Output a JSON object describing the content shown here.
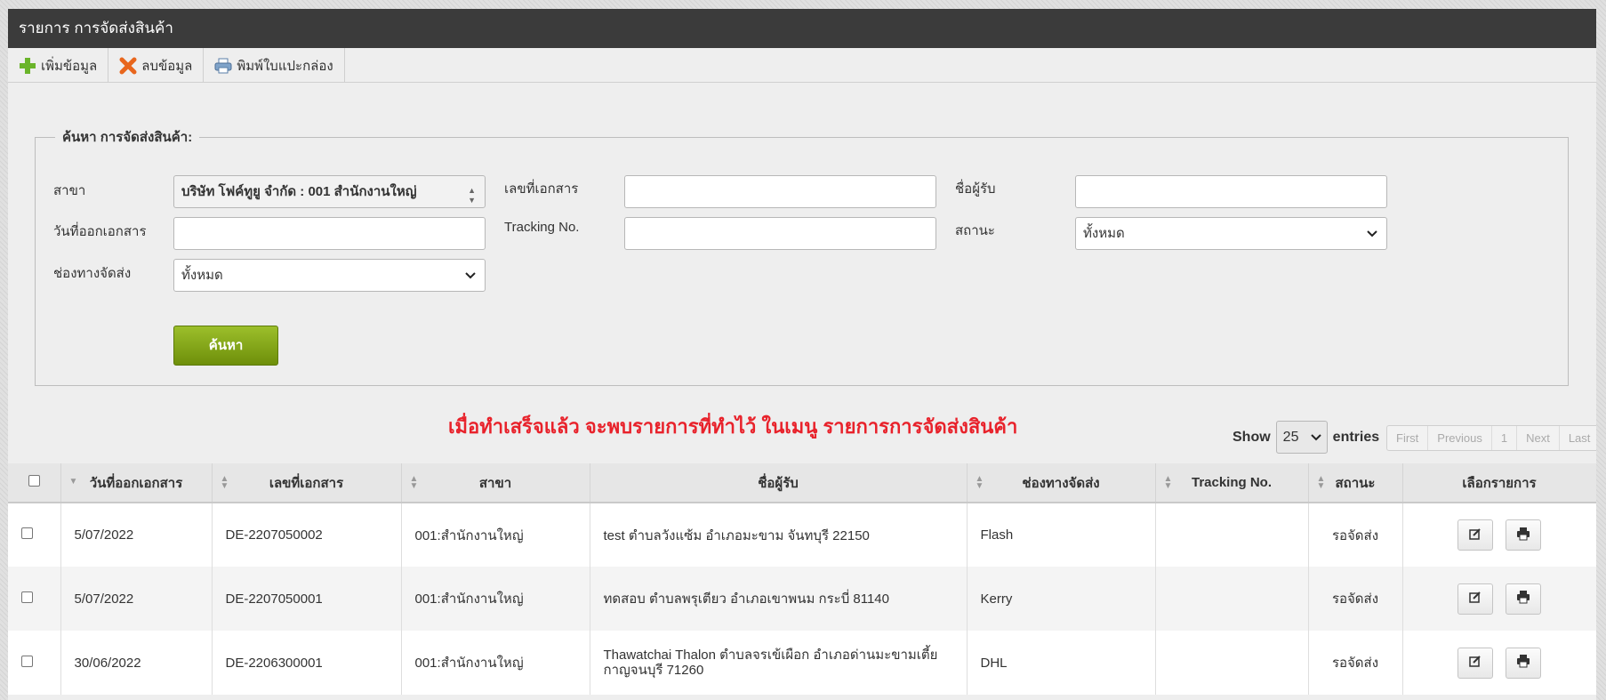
{
  "header": {
    "title": "รายการ การจัดส่งสินค้า"
  },
  "toolbar": {
    "add_label": "เพิ่มข้อมูล",
    "delete_label": "ลบข้อมูล",
    "print_label": "พิมพ์ใบแปะกล่อง"
  },
  "search": {
    "legend": "ค้นหา การจัดส่งสินค้า:",
    "branch_label": "สาขา",
    "branch_value": "บริษัท โฟค์ทูยู จำกัด : 001 สำนักงานใหญ่",
    "docno_label": "เลขที่เอกสาร",
    "docno_value": "",
    "recipient_label": "ชื่อผู้รับ",
    "recipient_value": "",
    "date_label": "วันที่ออกเอกสาร",
    "date_value": "",
    "tracking_label": "Tracking No.",
    "tracking_value": "",
    "status_label": "สถานะ",
    "status_value": "ทั้งหมด",
    "channel_label": "ช่องทางจัดส่ง",
    "channel_value": "ทั้งหมด",
    "submit_label": "ค้นหา"
  },
  "notice": "เมื่อทำเสร็จแล้ว จะพบรายการที่ทำไว้ ในเมนู รายการการจัดส่งสินค้า",
  "list": {
    "show_label": "Show",
    "length_value": "25",
    "entries_label": "entries",
    "pager": {
      "first": "First",
      "previous": "Previous",
      "page": "1",
      "next": "Next",
      "last": "Last"
    }
  },
  "table": {
    "columns": [
      "วันที่ออกเอกสาร",
      "เลขที่เอกสาร",
      "สาขา",
      "ชื่อผู้รับ",
      "ช่องทางจัดส่ง",
      "Tracking No.",
      "สถานะ",
      "เลือกรายการ"
    ],
    "rows": [
      {
        "date": "5/07/2022",
        "docno": "DE-2207050002",
        "branch": "001:สำนักงานใหญ่",
        "recipient": "test ตำบลวังแซ้ม อำเภอมะขาม จันทบุรี 22150",
        "channel": "Flash",
        "tracking": "",
        "status": "รอจัดส่ง"
      },
      {
        "date": "5/07/2022",
        "docno": "DE-2207050001",
        "branch": "001:สำนักงานใหญ่",
        "recipient": "ทดสอบ ตำบลพรุเตียว อำเภอเขาพนม กระบี่ 81140",
        "channel": "Kerry",
        "tracking": "",
        "status": "รอจัดส่ง"
      },
      {
        "date": "30/06/2022",
        "docno": "DE-2206300001",
        "branch": "001:สำนักงานใหญ่",
        "recipient": "Thawatchai Thalon ตำบลจรเข้เผือก อำเภอด่านมะขามเตี้ย กาญจนบุรี 71260",
        "channel": "DHL",
        "tracking": "",
        "status": "รอจัดส่ง"
      }
    ]
  }
}
